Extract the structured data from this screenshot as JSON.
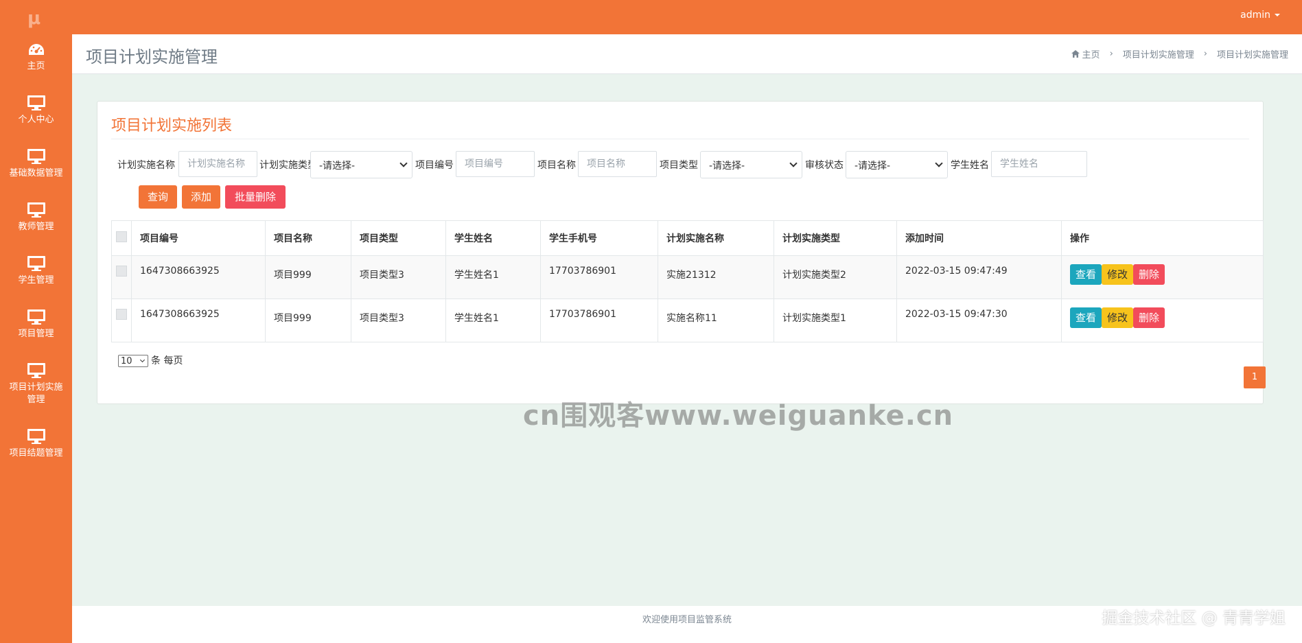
{
  "app": {
    "logo": "μ",
    "user": "admin"
  },
  "sidebar": {
    "items": [
      {
        "label": "主页",
        "icon": "dashboard-icon"
      },
      {
        "label": "个人中心",
        "icon": "monitor-icon"
      },
      {
        "label": "基础数据管理",
        "icon": "monitor-icon"
      },
      {
        "label": "教师管理",
        "icon": "monitor-icon"
      },
      {
        "label": "学生管理",
        "icon": "monitor-icon"
      },
      {
        "label": "项目管理",
        "icon": "monitor-icon"
      },
      {
        "label": "项目计划实施管理",
        "icon": "monitor-icon"
      },
      {
        "label": "项目结题管理",
        "icon": "monitor-icon"
      }
    ]
  },
  "header": {
    "title": "项目计划实施管理",
    "breadcrumb": [
      "主页",
      "项目计划实施管理",
      "项目计划实施管理"
    ]
  },
  "card": {
    "title": "项目计划实施列表"
  },
  "filters": {
    "plan_name": {
      "label": "计划实施名称",
      "placeholder": "计划实施名称"
    },
    "plan_type": {
      "label": "计划实施类型",
      "value": "-请选择-"
    },
    "project_no": {
      "label": "项目编号",
      "placeholder": "项目编号"
    },
    "project_name": {
      "label": "项目名称",
      "placeholder": "项目名称"
    },
    "project_type": {
      "label": "项目类型",
      "value": "-请选择-"
    },
    "audit_status": {
      "label": "审核状态",
      "value": "-请选择-"
    },
    "student_name": {
      "label": "学生姓名",
      "placeholder": "学生姓名"
    }
  },
  "buttons": {
    "query": "查询",
    "add": "添加",
    "batch_delete": "批量删除"
  },
  "table": {
    "columns": [
      "项目编号",
      "项目名称",
      "项目类型",
      "学生姓名",
      "学生手机号",
      "计划实施名称",
      "计划实施类型",
      "添加时间",
      "操作"
    ],
    "rows": [
      [
        "1647308663925",
        "项目999",
        "项目类型3",
        "学生姓名1",
        "17703786901",
        "实施21312",
        "计划实施类型2",
        "2022-03-15 09:47:49"
      ],
      [
        "1647308663925",
        "项目999",
        "项目类型3",
        "学生姓名1",
        "17703786901",
        "实施名称11",
        "计划实施类型1",
        "2022-03-15 09:47:30"
      ]
    ],
    "actions": {
      "view": "查看",
      "edit": "修改",
      "delete": "删除"
    }
  },
  "pagination": {
    "page_size": "10",
    "page_size_suffix": "条 每页",
    "current_page": "1"
  },
  "footer": {
    "text": "欢迎使用项目监管系统"
  },
  "watermark": {
    "text": "cn围观客www.weiguanke.cn"
  },
  "corner_text": "掘金技术社区 @ 青青学姐",
  "colors": {
    "primary": "#F27437",
    "view": "#1ca6bd",
    "edit": "#f7c31c",
    "delete": "#f24c5b"
  }
}
